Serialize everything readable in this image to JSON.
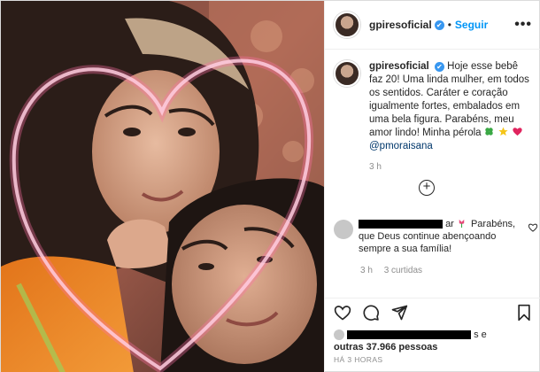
{
  "header": {
    "username": "gpiresoficial",
    "verified_mark": "✔",
    "separator": "•",
    "follow_label": "Seguir",
    "more_label": "•••"
  },
  "caption": {
    "username": "gpiresoficial",
    "verified_mark": "✔",
    "text": "Hoje esse bebê faz 20! Uma linda mulher, em todos os sentidos. Caráter e coração igualmente fortes, embalados em uma bela figura. Parabéns, meu amor lindo! Minha pérola",
    "mention": "@pmoraisana",
    "time": "3 h",
    "emojis": [
      "clover-emoji",
      "star-emoji",
      "heart-emoji"
    ]
  },
  "load_more_label": "+",
  "comment": {
    "text_prefix": "ar",
    "text": "Parabéns, que Deus continue abençoando sempre a sua família!",
    "time": "3 h",
    "likes": "3 curtidas"
  },
  "likes": {
    "suffix": "s e",
    "text": "outras 37.966 pessoas"
  },
  "posted_ago": "HÁ 3 HORAS",
  "colors": {
    "link_blue": "#0095f6",
    "verified_blue": "#3897f0",
    "muted": "#8e8e8e",
    "border": "#dbdbdb"
  }
}
